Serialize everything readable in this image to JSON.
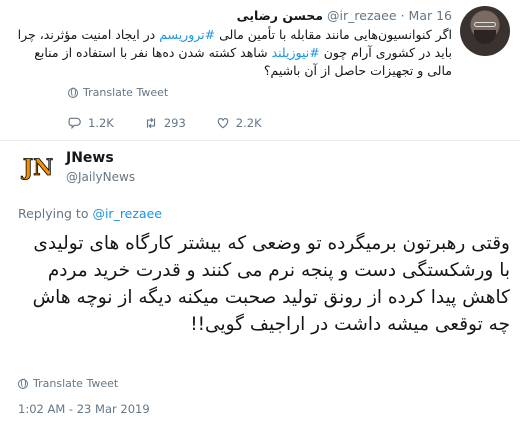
{
  "original": {
    "display_name": "محسن رضایی",
    "handle": "@ir_rezaee",
    "separator": "·",
    "date": "Mar 16",
    "text_part1": "اگر کنوانسیون‌هایی مانند مقابله با تأمین مالی ",
    "hashtag1": "#تروریسم",
    "text_part2": " در ایجاد امنیت مؤثرند، چرا باید در کشوری آرام چون ",
    "hashtag2": "#نیوزیلند",
    "text_part3": " شاهد کشته شدن ده‌ها نفر با استفاده از منابع مالی و تجهیزات حاصل از آن باشیم؟",
    "translate_label": "Translate Tweet",
    "replies_count": "1.2K",
    "retweets_count": "293",
    "likes_count": "2.2K"
  },
  "reply": {
    "display_name": "JNews",
    "handle": "@JailyNews",
    "logo_text": "JN",
    "replying_to_prefix": "Replying to ",
    "replying_to_handle": "@ir_rezaee",
    "text": "وقتی رهبرتون برمیگرده تو وضعی که بیشتر کارگاه های تولیدی با ورشکستگی دست و پنجه نرم می کنند و قدرت خرید مردم کاهش پیدا کرده از رونق تولید صحبت میکنه دیگه از نوچه هاش چه توقعی میشه داشت در اراجیف گویی!!",
    "translate_label": "Translate Tweet",
    "timestamp": "1:02 AM - 23 Mar 2019"
  },
  "colors": {
    "link": "#1b95e0",
    "secondary_text": "#657786",
    "divider": "#e6ecf0",
    "logo_orange": "#f39200"
  }
}
